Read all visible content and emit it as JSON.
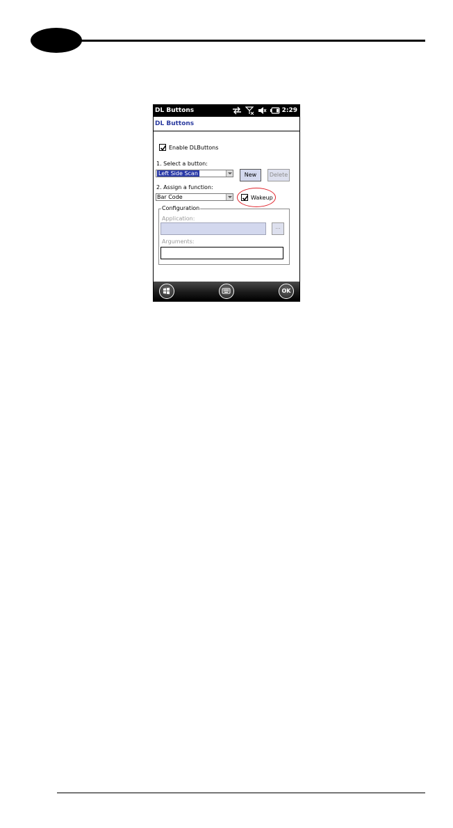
{
  "device": {
    "statusbar": {
      "title": "DL Buttons",
      "clock": "2:29",
      "icons": [
        "sync-icon",
        "no-signal-icon",
        "volume-muted-icon",
        "battery-icon"
      ]
    },
    "app_title": "DL Buttons",
    "enable_checkbox": {
      "label": "Enable DLButtons",
      "checked": true
    },
    "select_button": {
      "label": "1. Select a button:",
      "value": "Left Side Scan",
      "new_label": "New",
      "delete_label": "Delete"
    },
    "assign_function": {
      "label": "2. Assign a function:",
      "value": "Bar Code",
      "wakeup_label": "Wakeup",
      "wakeup_checked": true
    },
    "configuration": {
      "legend": "Configuration",
      "application_label": "Application:",
      "application_value": "",
      "browse_label": "...",
      "arguments_label": "Arguments:",
      "arguments_value": ""
    },
    "taskbar": {
      "ok_label": "OK"
    }
  },
  "colors": {
    "title_blue": "#2a3a9f",
    "selection_blue": "#2a3aa8",
    "highlight_red": "#e0222a"
  }
}
